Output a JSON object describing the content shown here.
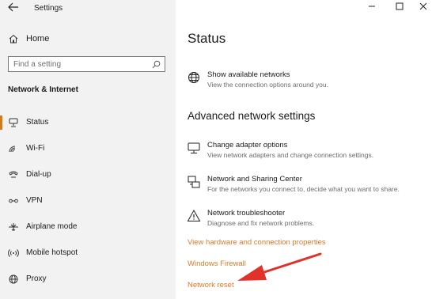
{
  "app": {
    "title": "Settings"
  },
  "sidebar": {
    "home_label": "Home",
    "search_placeholder": "Find a setting",
    "section_title": "Network & Internet",
    "items": [
      {
        "label": "Status",
        "icon": "status-icon",
        "active": true
      },
      {
        "label": "Wi-Fi",
        "icon": "wifi-icon"
      },
      {
        "label": "Dial-up",
        "icon": "dialup-icon"
      },
      {
        "label": "VPN",
        "icon": "vpn-icon"
      },
      {
        "label": "Airplane mode",
        "icon": "airplane-icon"
      },
      {
        "label": "Mobile hotspot",
        "icon": "hotspot-icon"
      },
      {
        "label": "Proxy",
        "icon": "globe-icon"
      }
    ]
  },
  "main": {
    "title": "Status",
    "show_networks": {
      "title": "Show available networks",
      "desc": "View the connection options around you."
    },
    "advanced_title": "Advanced network settings",
    "settings": [
      {
        "title": "Change adapter options",
        "desc": "View network adapters and change connection settings."
      },
      {
        "title": "Network and Sharing Center",
        "desc": "For the networks you connect to, decide what you want to share."
      },
      {
        "title": "Network troubleshooter",
        "desc": "Diagnose and fix network problems."
      }
    ],
    "links": [
      "View hardware and connection properties",
      "Windows Firewall",
      "Network reset"
    ]
  },
  "colors": {
    "accent": "#d47b1e",
    "link": "#d27c2c",
    "annotation_arrow": "#e0322b"
  }
}
